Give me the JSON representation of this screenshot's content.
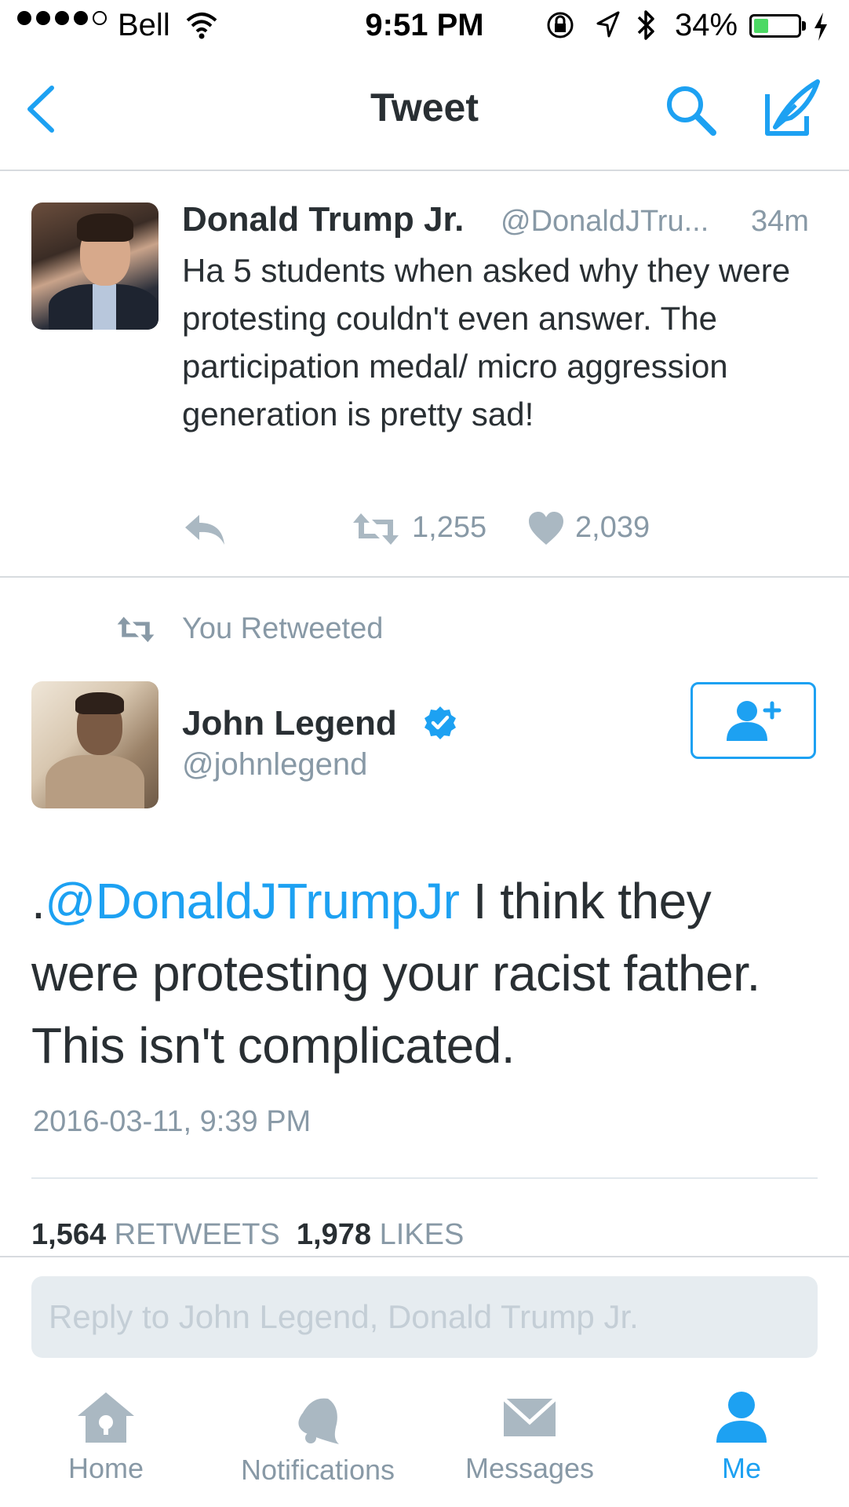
{
  "status_bar": {
    "carrier": "Bell",
    "time": "9:51 PM",
    "battery_percent": "34%",
    "battery_level": 0.34
  },
  "nav": {
    "title": "Tweet",
    "back_icon": "chevron-left-icon",
    "search_icon": "search-icon",
    "compose_icon": "compose-icon"
  },
  "tweet1": {
    "name": "Donald Trump Jr.",
    "handle": "@DonaldJTru...",
    "time": "34m",
    "text": "Ha 5 students when asked why they were protesting couldn't even answer. The participation medal/ micro aggression generation is pretty sad!",
    "retweets": "1,255",
    "likes": "2,039"
  },
  "retweeted_label": "You Retweeted",
  "tweet2": {
    "name": "John Legend",
    "handle": "@johnlegend",
    "text_prefix": ".",
    "mention": "@DonaldJTrumpJr",
    "text_body": " I think they were protesting your racist father. This isn't complicated.",
    "date": "2016-03-11, 9:39 PM",
    "retweets_count": "1,564",
    "retweets_label": "RETWEETS",
    "likes_count": "1,978",
    "likes_label": "LIKES"
  },
  "reply": {
    "placeholder": "Reply to John Legend, Donald Trump Jr."
  },
  "tabs": [
    {
      "label": "Home",
      "icon": "home-icon"
    },
    {
      "label": "Notifications",
      "icon": "bell-icon"
    },
    {
      "label": "Messages",
      "icon": "envelope-icon"
    },
    {
      "label": "Me",
      "icon": "person-icon"
    }
  ],
  "colors": {
    "accent": "#1da1f2",
    "muted": "#8899a6",
    "text": "#292f33",
    "battery": "#4cd964"
  }
}
